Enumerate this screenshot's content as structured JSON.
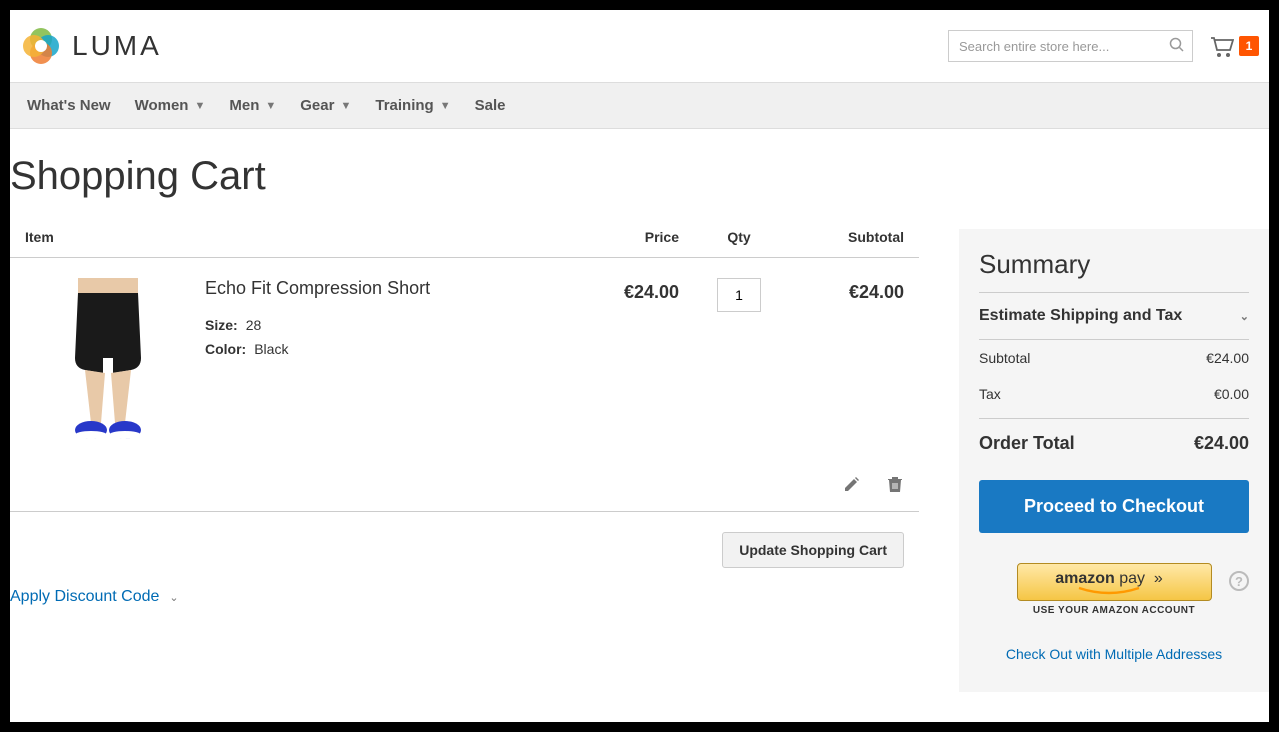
{
  "header": {
    "logo_text": "LUMA",
    "search_placeholder": "Search entire store here...",
    "cart_count": "1"
  },
  "nav": {
    "items": [
      "What's New",
      "Women",
      "Men",
      "Gear",
      "Training",
      "Sale"
    ]
  },
  "page": {
    "title": "Shopping Cart"
  },
  "cart": {
    "headers": {
      "item": "Item",
      "price": "Price",
      "qty": "Qty",
      "subtotal": "Subtotal"
    },
    "items": [
      {
        "name": "Echo Fit Compression Short",
        "size_label": "Size:",
        "size_value": "28",
        "color_label": "Color:",
        "color_value": "Black",
        "price": "€24.00",
        "qty": "1",
        "subtotal": "€24.00"
      }
    ],
    "update_label": "Update Shopping Cart",
    "discount_label": "Apply Discount Code"
  },
  "summary": {
    "title": "Summary",
    "estimate_label": "Estimate Shipping and Tax",
    "subtotal_label": "Subtotal",
    "subtotal_value": "€24.00",
    "tax_label": "Tax",
    "tax_value": "€0.00",
    "total_label": "Order Total",
    "total_value": "€24.00",
    "checkout_label": "Proceed to Checkout",
    "amazon_label": "amazon pay",
    "amazon_sub": "USE YOUR AMAZON ACCOUNT",
    "multi_label": "Check Out with Multiple Addresses"
  }
}
